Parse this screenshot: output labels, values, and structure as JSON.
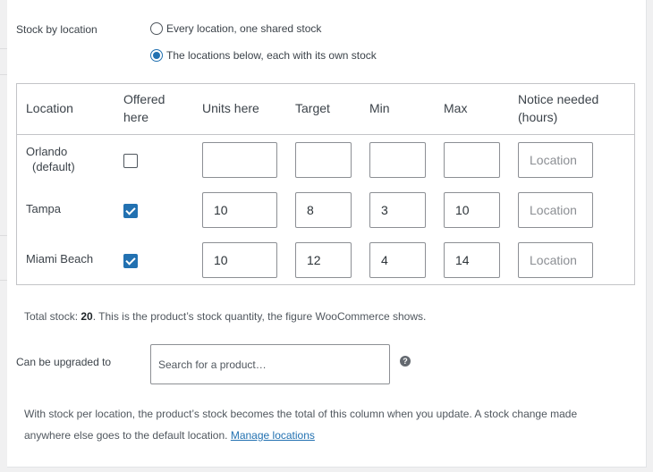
{
  "stock_mode": {
    "label": "Stock by location",
    "options": [
      {
        "label": "Every location, one shared stock",
        "checked": false
      },
      {
        "label": "The locations below, each with its own stock",
        "checked": true
      }
    ]
  },
  "table": {
    "headers": {
      "location": "Location",
      "offered_1": "Offered",
      "offered_2": "here",
      "units": "Units here",
      "target": "Target",
      "min": "Min",
      "max": "Max",
      "notice_1": "Notice needed",
      "notice_2": "(hours)"
    },
    "notice_placeholder": "Location",
    "rows": [
      {
        "name_1": "Orlando",
        "name_2": "(default)",
        "offered": false,
        "units": "",
        "target": "",
        "min": "",
        "max": ""
      },
      {
        "name_1": "Tampa",
        "name_2": "",
        "offered": true,
        "units": "10",
        "target": "8",
        "min": "3",
        "max": "10"
      },
      {
        "name_1": "Miami Beach",
        "name_2": "",
        "offered": true,
        "units": "10",
        "target": "12",
        "min": "4",
        "max": "14"
      }
    ]
  },
  "total": {
    "prefix": "Total stock: ",
    "value": "20",
    "suffix": ". This is the product’s stock quantity, the figure WooCommerce shows."
  },
  "upgrade": {
    "label": "Can be upgraded to",
    "placeholder": "Search for a product…",
    "help_icon": "?"
  },
  "footer": {
    "text": "With stock per location, the product’s stock becomes the total of this column when you update. A stock change made anywhere else goes to the default location. ",
    "link": "Manage locations"
  },
  "colors": {
    "accent": "#2271b1",
    "border": "#c3c4c7"
  },
  "icons": [
    "radio-unchecked",
    "radio-checked",
    "checkbox-unchecked",
    "checkbox-checked",
    "help-icon"
  ]
}
